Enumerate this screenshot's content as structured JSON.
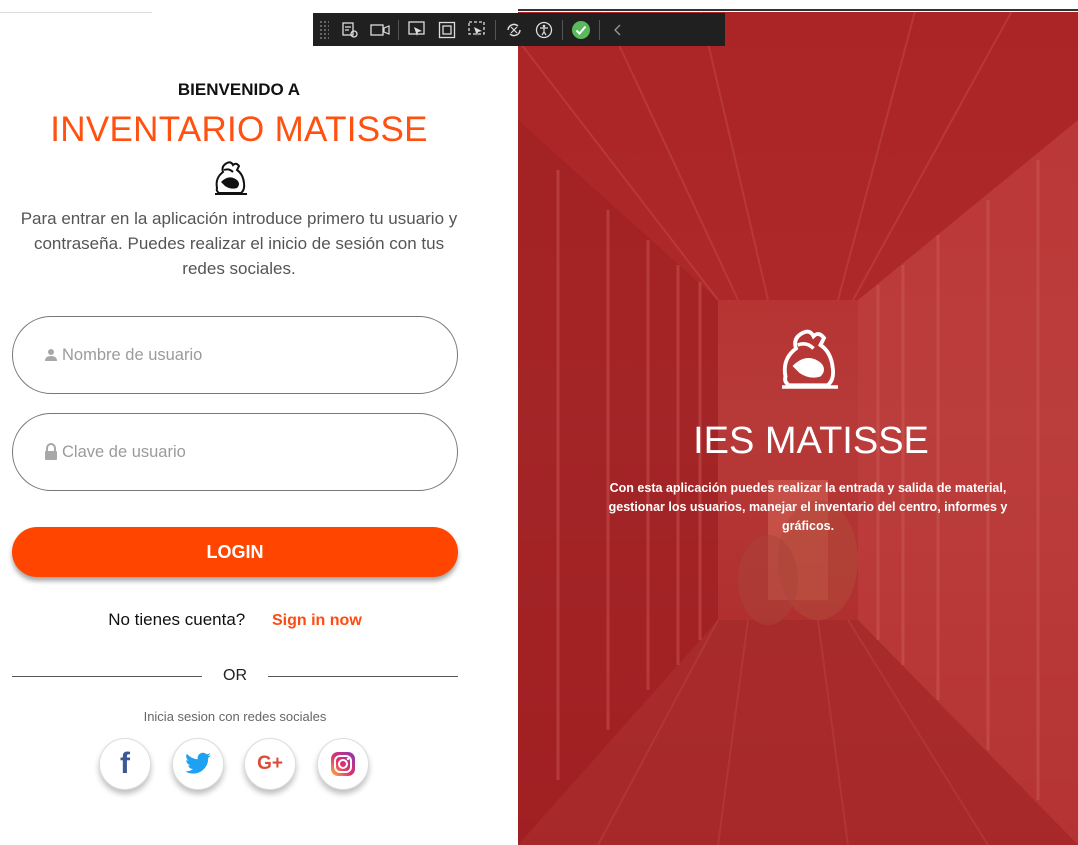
{
  "toolbar": {
    "icons": [
      "live-visual-tree-icon",
      "display-layout-icon",
      "select-element-icon",
      "display-adorners-icon",
      "track-focus-icon",
      "hot-reload-icon",
      "accessibility-icon",
      "binding-ok-icon",
      "collapse-chevron-icon"
    ],
    "accent": "#4caf50"
  },
  "login": {
    "welcome": "BIENVENIDO A",
    "title": "INVENTARIO MATISSE",
    "intro": "Para entrar en la aplicación introduce primero tu usuario y contraseña. Puedes realizar el inicio de sesión con tus redes sociales.",
    "username_placeholder": "Nombre de usuario",
    "password_placeholder": "Clave de usuario",
    "login_label": "LOGIN",
    "no_account": "No tienes cuenta?",
    "signup_link": "Sign in now",
    "or": "OR",
    "social_caption": "Inicia sesion con redes sociales",
    "accent": "#ff4500"
  },
  "social": {
    "facebook": "f",
    "google": "G+"
  },
  "hero": {
    "title": "IES MATISSE",
    "text": "Con esta aplicación puedes realizar la entrada y salida de material, gestionar los usuarios, manejar el inventario del centro, informes y gráficos.",
    "overlay_color": "#b8292b"
  }
}
